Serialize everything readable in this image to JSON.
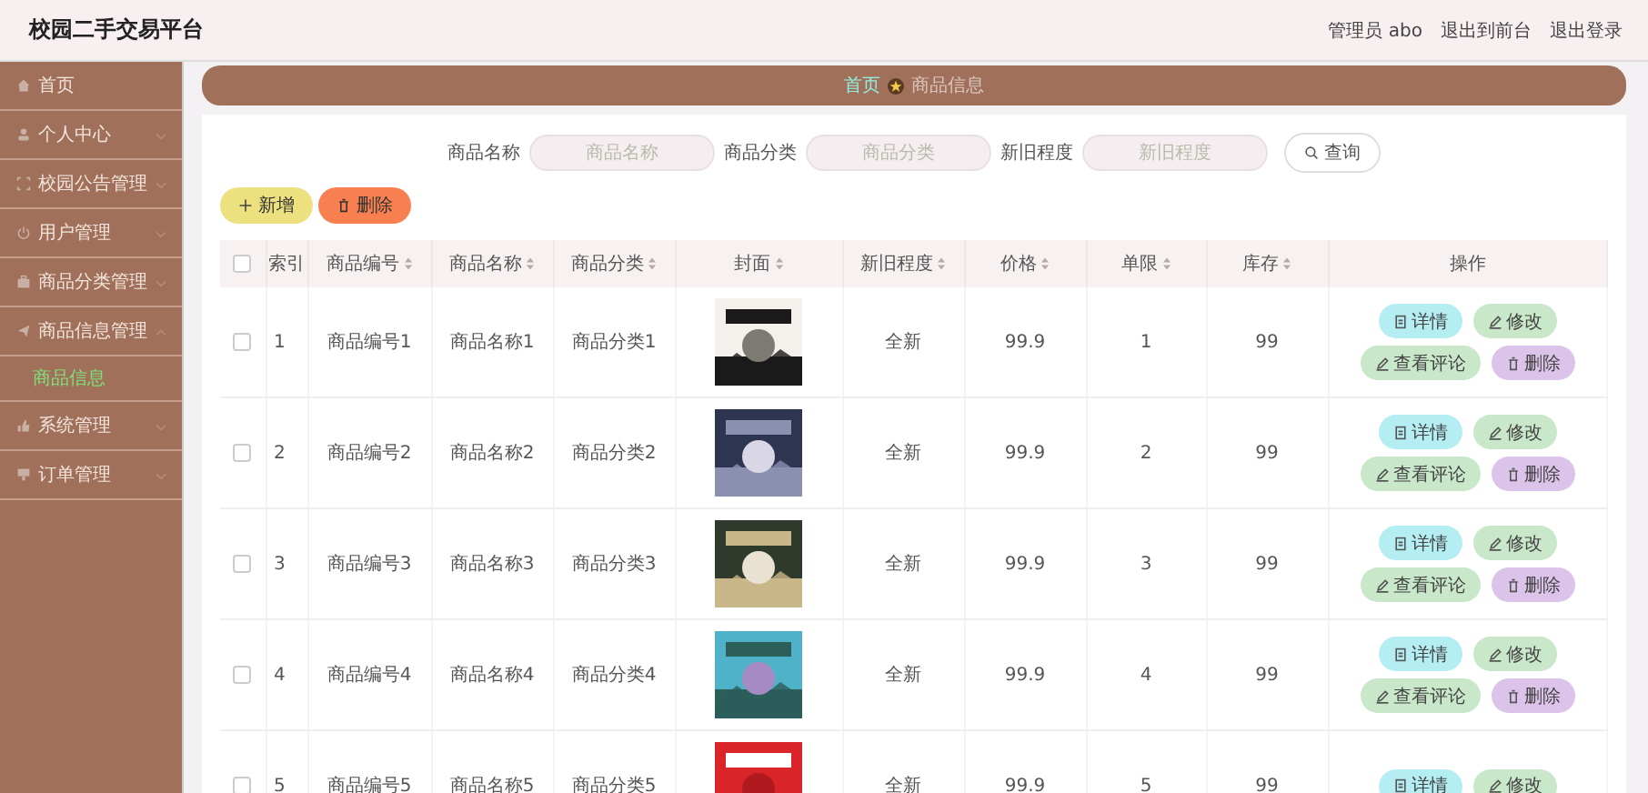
{
  "header": {
    "title": "校园二手交易平台",
    "user": "管理员 abo",
    "links": [
      "退出到前台",
      "退出登录"
    ]
  },
  "sidebar": {
    "items": [
      {
        "label": "首页",
        "has_arrow": false
      },
      {
        "label": "个人中心",
        "expanded": false,
        "has_arrow": true
      },
      {
        "label": "校园公告管理",
        "expanded": false,
        "has_arrow": true
      },
      {
        "label": "用户管理",
        "expanded": false,
        "has_arrow": true
      },
      {
        "label": "商品分类管理",
        "expanded": false,
        "has_arrow": true
      },
      {
        "label": "商品信息管理",
        "expanded": true,
        "has_arrow": true,
        "children": [
          {
            "label": "商品信息",
            "selected": true
          }
        ]
      },
      {
        "label": "系统管理",
        "expanded": false,
        "has_arrow": true
      },
      {
        "label": "订单管理",
        "expanded": false,
        "has_arrow": true
      }
    ]
  },
  "breadcrumb": [
    "首页",
    "商品信息"
  ],
  "search": {
    "fields": [
      {
        "label": "商品名称",
        "placeholder": "商品名称"
      },
      {
        "label": "商品分类",
        "placeholder": "商品分类"
      },
      {
        "label": "新旧程度",
        "placeholder": "新旧程度"
      }
    ],
    "button": "查询"
  },
  "toolbar": [
    {
      "kind": "add",
      "label": "新增"
    },
    {
      "kind": "delete",
      "label": "删除"
    }
  ],
  "table": {
    "select_all_checked": false,
    "columns": [
      {
        "label": "索引",
        "sortable": false
      },
      {
        "label": "商品编号",
        "sortable": true
      },
      {
        "label": "商品名称",
        "sortable": true
      },
      {
        "label": "商品分类",
        "sortable": true
      },
      {
        "label": "封面",
        "sortable": true
      },
      {
        "label": "新旧程度",
        "sortable": true
      },
      {
        "label": "价格",
        "sortable": true
      },
      {
        "label": "单限",
        "sortable": true
      },
      {
        "label": "库存",
        "sortable": true
      },
      {
        "label": "操作",
        "sortable": false
      }
    ],
    "rows": [
      {
        "checked": false,
        "cells": [
          "1",
          "商品编号1",
          "商品名称1",
          "商品分类1"
        ],
        "cover": {
          "kind": "picture"
        },
        "rest": [
          "全新",
          "99.9",
          "1",
          "99"
        ],
        "actions": [
          {
            "kind": "detail",
            "label": "详情"
          },
          {
            "kind": "edit",
            "label": "修改"
          },
          {
            "kind": "review",
            "label": "查看评论"
          },
          {
            "kind": "delete",
            "label": "删除"
          }
        ]
      },
      {
        "checked": false,
        "cells": [
          "2",
          "商品编号2",
          "商品名称2",
          "商品分类2"
        ],
        "cover": {
          "kind": "picture"
        },
        "rest": [
          "全新",
          "99.9",
          "2",
          "99"
        ],
        "actions": [
          {
            "kind": "detail",
            "label": "详情"
          },
          {
            "kind": "edit",
            "label": "修改"
          },
          {
            "kind": "review",
            "label": "查看评论"
          },
          {
            "kind": "delete",
            "label": "删除"
          }
        ]
      },
      {
        "checked": false,
        "cells": [
          "3",
          "商品编号3",
          "商品名称3",
          "商品分类3"
        ],
        "cover": {
          "kind": "picture"
        },
        "rest": [
          "全新",
          "99.9",
          "3",
          "99"
        ],
        "actions": [
          {
            "kind": "detail",
            "label": "详情"
          },
          {
            "kind": "edit",
            "label": "修改"
          },
          {
            "kind": "review",
            "label": "查看评论"
          },
          {
            "kind": "delete",
            "label": "删除"
          }
        ]
      },
      {
        "checked": false,
        "cells": [
          "4",
          "商品编号4",
          "商品名称4",
          "商品分类4"
        ],
        "cover": {
          "kind": "picture"
        },
        "rest": [
          "全新",
          "99.9",
          "4",
          "99"
        ],
        "actions": [
          {
            "kind": "detail",
            "label": "详情"
          },
          {
            "kind": "edit",
            "label": "修改"
          },
          {
            "kind": "review",
            "label": "查看评论"
          },
          {
            "kind": "delete",
            "label": "删除"
          }
        ]
      },
      {
        "checked": false,
        "cells": [
          "5",
          "商品编号5",
          "商品名称5",
          "商品分类5"
        ],
        "cover": {
          "kind": "picture"
        },
        "rest": [
          "全新",
          "99.9",
          "5",
          "99"
        ],
        "actions": [
          {
            "kind": "detail",
            "label": "详情"
          },
          {
            "kind": "edit",
            "label": "修改"
          }
        ]
      }
    ]
  }
}
